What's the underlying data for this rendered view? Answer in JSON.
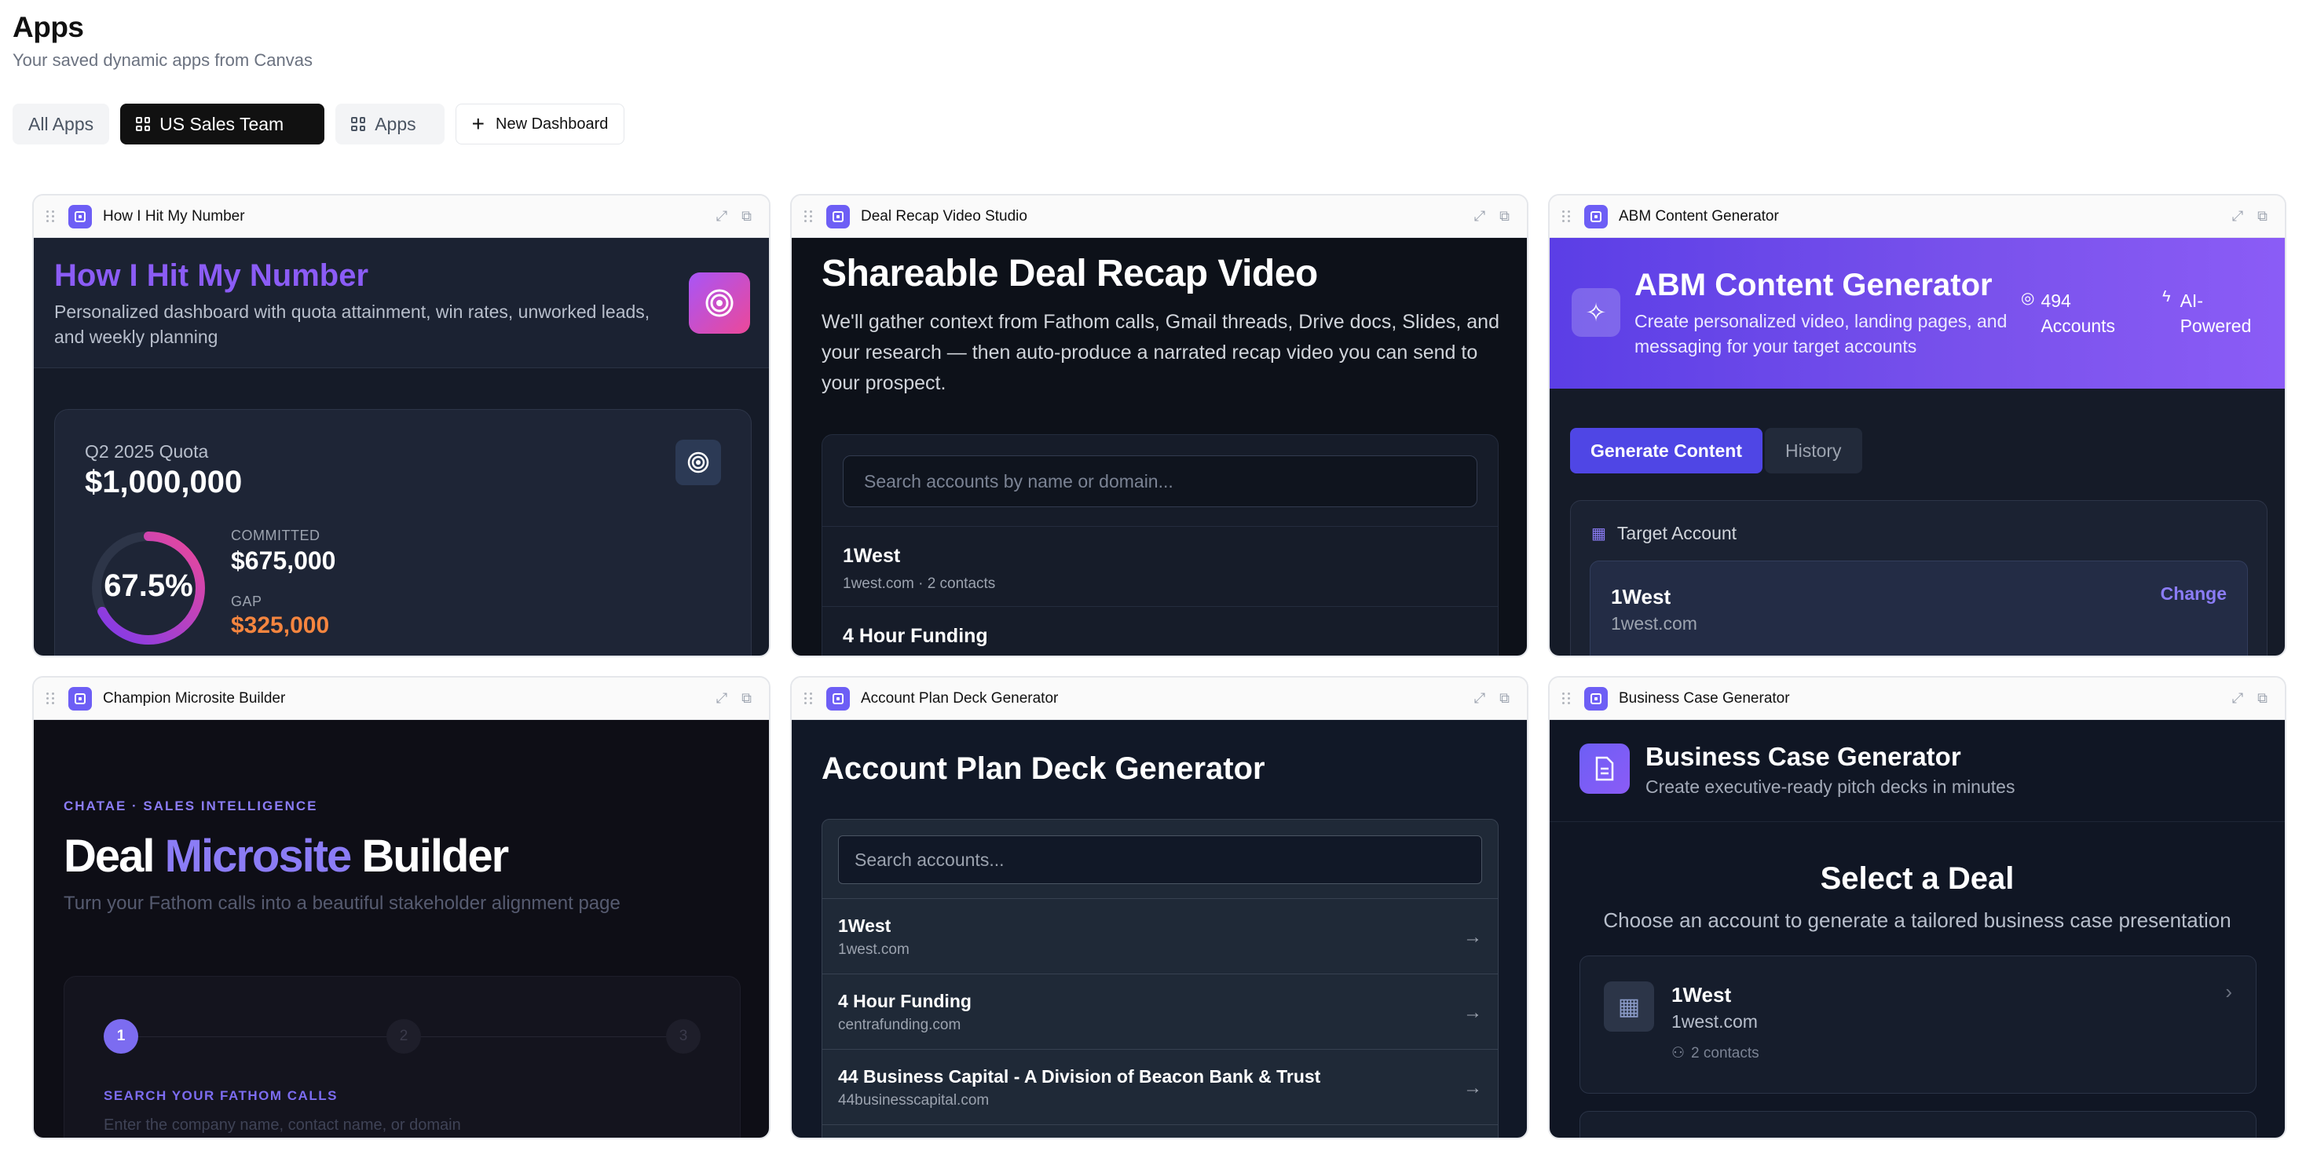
{
  "page": {
    "title": "Apps",
    "subtitle": "Your saved dynamic apps from Canvas"
  },
  "tabs": {
    "all": "All Apps",
    "sales": "US Sales Team",
    "apps": "Apps",
    "new": "New Dashboard"
  },
  "cards": [
    {
      "title": "How I Hit My Number"
    },
    {
      "title": "Deal Recap Video Studio"
    },
    {
      "title": "ABM Content Generator"
    },
    {
      "title": "Champion Microsite Builder"
    },
    {
      "title": "Account Plan Deck Generator"
    },
    {
      "title": "Business Case Generator"
    }
  ],
  "c1": {
    "heading": "How I Hit My Number",
    "desc": "Personalized dashboard with quota attainment, win rates, unworked leads, and weekly planning",
    "quota_label": "Q2 2025 Quota",
    "quota_value": "$1,000,000",
    "percent": "67.5%",
    "percent_value": 67.5,
    "committed_label": "COMMITTED",
    "committed_value": "$675,000",
    "gap_label": "GAP",
    "gap_value": "$325,000"
  },
  "c2": {
    "heading": "Shareable Deal Recap Video",
    "desc": "We'll gather context from Fathom calls, Gmail threads, Drive docs, Slides, and your research — then auto-produce a narrated recap video you can send to your prospect.",
    "search_placeholder": "Search accounts by name or domain...",
    "items": [
      {
        "name": "1West",
        "meta": "1west.com · 2 contacts"
      },
      {
        "name": "4 Hour Funding",
        "meta": ""
      }
    ]
  },
  "c3": {
    "heading": "ABM Content Generator",
    "desc": "Create personalized video, landing pages, and messaging for your target accounts",
    "stat1": "494 Accounts",
    "stat2": "AI-Powered",
    "btn_generate": "Generate Content",
    "btn_history": "History",
    "target_label": "Target Account",
    "account_name": "1West",
    "account_domain": "1west.com",
    "change": "Change"
  },
  "c4": {
    "eyebrow": "CHATAE · SALES INTELLIGENCE",
    "h_deal": "Deal",
    "h_micro": "Microsite",
    "h_builder": "Builder",
    "desc": "Turn your Fathom calls into a beautiful stakeholder alignment page",
    "step1": "1",
    "step2": "2",
    "step3": "3",
    "step_label": "SEARCH YOUR FATHOM CALLS",
    "step_placeholder": "Enter the company name, contact name, or domain"
  },
  "c5": {
    "heading": "Account Plan Deck Generator",
    "search_placeholder": "Search accounts...",
    "items": [
      {
        "name": "1West",
        "domain": "1west.com"
      },
      {
        "name": "4 Hour Funding",
        "domain": "centrafunding.com"
      },
      {
        "name": "44 Business Capital - A Division of Beacon Bank & Trust",
        "domain": "44businesscapital.com"
      }
    ]
  },
  "c6": {
    "heading": "Business Case Generator",
    "sub": "Create executive-ready pitch decks in minutes",
    "select_title": "Select a Deal",
    "select_desc": "Choose an account to generate a tailored business case presentation",
    "deal_name": "1West",
    "deal_domain": "1west.com",
    "deal_contacts": "2 contacts"
  },
  "colors": {
    "accent": "#6d5ef5",
    "orange": "#f5853f",
    "purple_text": "#8b7cf6"
  }
}
